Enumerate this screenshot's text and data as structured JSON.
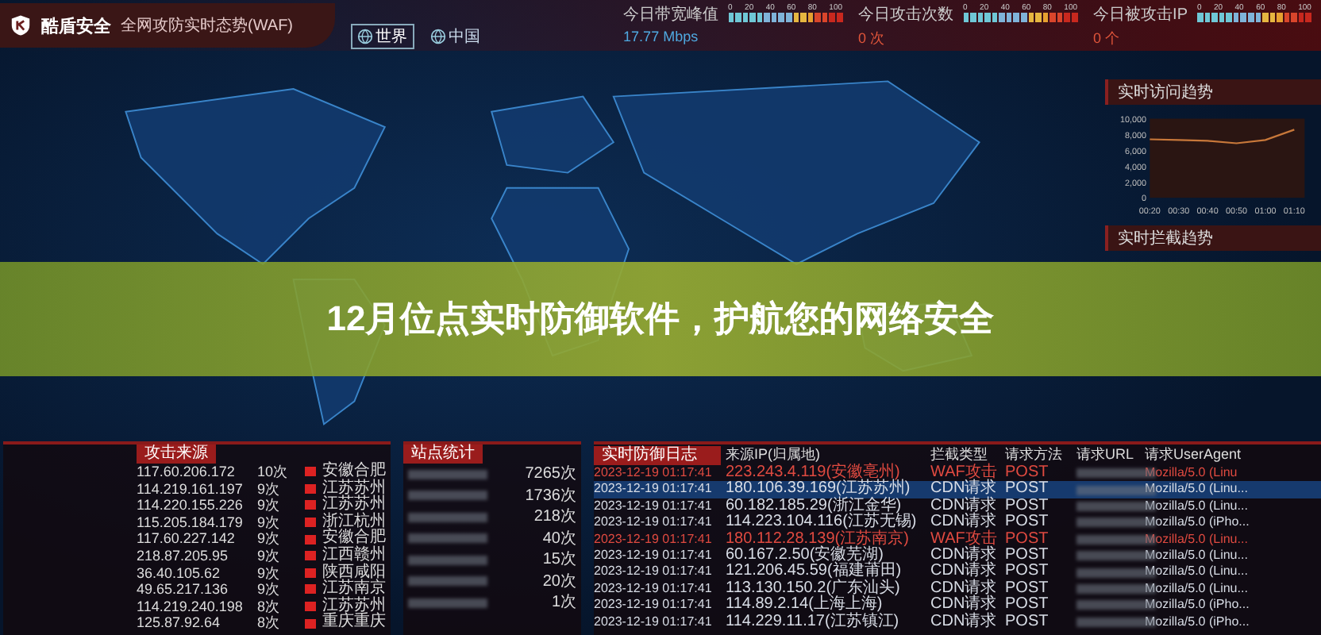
{
  "header": {
    "brand": "酷盾安全",
    "subtitle": "全网攻防实时态势(WAF)",
    "tabs": [
      {
        "label": "世界",
        "selected": true
      },
      {
        "label": "中国",
        "selected": false
      }
    ],
    "stats": [
      {
        "label": "今日带宽峰值",
        "value": "17.77 Mbps",
        "kind": "bandwidth",
        "ticks": [
          "0",
          "20",
          "40",
          "60",
          "80",
          "100"
        ]
      },
      {
        "label": "今日攻击次数",
        "value": "0 次",
        "kind": "count",
        "ticks": [
          "0",
          "20",
          "40",
          "60",
          "80",
          "100"
        ]
      },
      {
        "label": "今日被攻击IP",
        "value": "0 个",
        "kind": "count",
        "ticks": [
          "0",
          "20",
          "40",
          "60",
          "80",
          "100"
        ]
      }
    ]
  },
  "trend_panel": {
    "title": "实时访问趋势",
    "chart_data": {
      "type": "line",
      "x": [
        "00:20",
        "00:30",
        "00:40",
        "00:50",
        "01:00",
        "01:10"
      ],
      "ylim": [
        0,
        10000
      ],
      "yticks": [
        {
          "value": 0,
          "label": "0"
        },
        {
          "value": 2000,
          "label": "2,000"
        },
        {
          "value": 4000,
          "label": "4,000"
        },
        {
          "value": 6000,
          "label": "6,000"
        },
        {
          "value": 8000,
          "label": "8,000"
        },
        {
          "value": 10000,
          "label": "10,000"
        }
      ],
      "series": [
        {
          "color": "#c8783a",
          "values": [
            7400,
            7300,
            7200,
            6900,
            7300,
            8600
          ]
        }
      ]
    }
  },
  "intercept_panel": {
    "title": "实时拦截趋势"
  },
  "banner": {
    "title": "12月位点实时防御软件，护航您的网络安全"
  },
  "sources": {
    "title": "攻击来源",
    "rows": [
      {
        "ip": "117.60.206.172",
        "count": "10次",
        "location": "安徽合肥"
      },
      {
        "ip": "114.219.161.197",
        "count": "9次",
        "location": "江苏苏州"
      },
      {
        "ip": "114.220.155.226",
        "count": "9次",
        "location": "江苏苏州"
      },
      {
        "ip": "115.205.184.179",
        "count": "9次",
        "location": "浙江杭州"
      },
      {
        "ip": "117.60.227.142",
        "count": "9次",
        "location": "安徽合肥"
      },
      {
        "ip": "218.87.205.95",
        "count": "9次",
        "location": "江西赣州"
      },
      {
        "ip": "36.40.105.62",
        "count": "9次",
        "location": "陕西咸阳"
      },
      {
        "ip": "49.65.217.136",
        "count": "9次",
        "location": "江苏南京"
      },
      {
        "ip": "114.219.240.198",
        "count": "8次",
        "location": "江苏苏州"
      },
      {
        "ip": "125.87.92.64",
        "count": "8次",
        "location": "重庆重庆"
      }
    ]
  },
  "sites": {
    "title": "站点统计",
    "rows": [
      {
        "count": "7265次"
      },
      {
        "count": "1736次"
      },
      {
        "count": "218次"
      },
      {
        "count": "40次"
      },
      {
        "count": "15次"
      },
      {
        "count": "20次"
      },
      {
        "count": "1次"
      }
    ]
  },
  "log": {
    "title": "实时防御日志",
    "columns": [
      "来源IP(归属地)",
      "拦截类型",
      "请求方法",
      "请求URL",
      "请求UserAgent"
    ],
    "rows": [
      {
        "time": "2023-12-19 01:17:41",
        "ip": "223.243.4.119(安徽亳州)",
        "type": "WAF攻击",
        "method": "POST",
        "agent": "Mozilla/5.0 (Linu",
        "kind": "waf",
        "selected": false
      },
      {
        "time": "2023-12-19 01:17:41",
        "ip": "180.106.39.169(江苏苏州)",
        "type": "CDN请求",
        "method": "POST",
        "agent": "Mozilla/5.0 (Linu...",
        "kind": "cdn",
        "selected": true
      },
      {
        "time": "2023-12-19 01:17:41",
        "ip": "60.182.185.29(浙江金华)",
        "type": "CDN请求",
        "method": "POST",
        "agent": "Mozilla/5.0 (Linu...",
        "kind": "cdn",
        "selected": false
      },
      {
        "time": "2023-12-19 01:17:41",
        "ip": "114.223.104.116(江苏无锡)",
        "type": "CDN请求",
        "method": "POST",
        "agent": "Mozilla/5.0 (iPho...",
        "kind": "cdn",
        "selected": false
      },
      {
        "time": "2023-12-19 01:17:41",
        "ip": "180.112.28.139(江苏南京)",
        "type": "WAF攻击",
        "method": "POST",
        "agent": "Mozilla/5.0 (Linu...",
        "kind": "waf",
        "selected": false
      },
      {
        "time": "2023-12-19 01:17:41",
        "ip": "60.167.2.50(安徽芜湖)",
        "type": "CDN请求",
        "method": "POST",
        "agent": "Mozilla/5.0 (Linu...",
        "kind": "cdn",
        "selected": false
      },
      {
        "time": "2023-12-19 01:17:41",
        "ip": "121.206.45.59(福建莆田)",
        "type": "CDN请求",
        "method": "POST",
        "agent": "Mozilla/5.0 (Linu...",
        "kind": "cdn",
        "selected": false
      },
      {
        "time": "2023-12-19 01:17:41",
        "ip": "113.130.150.2(广东汕头)",
        "type": "CDN请求",
        "method": "POST",
        "agent": "Mozilla/5.0 (Linu...",
        "kind": "cdn",
        "selected": false
      },
      {
        "time": "2023-12-19 01:17:41",
        "ip": "114.89.2.14(上海上海)",
        "type": "CDN请求",
        "method": "POST",
        "agent": "Mozilla/5.0 (iPho...",
        "kind": "cdn",
        "selected": false
      },
      {
        "time": "2023-12-19 01:17:41",
        "ip": "114.229.11.17(江苏镇江)",
        "type": "CDN请求",
        "method": "POST",
        "agent": "Mozilla/5.0 (iPho...",
        "kind": "cdn",
        "selected": false
      }
    ]
  }
}
